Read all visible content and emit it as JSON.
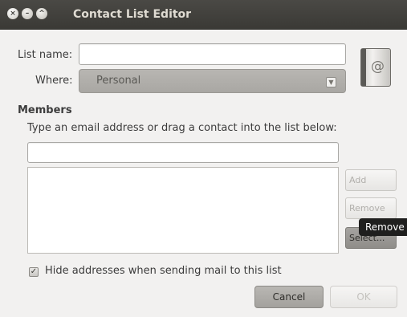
{
  "window": {
    "title": "Contact List Editor",
    "close_glyph": "×",
    "minimize_glyph": "–",
    "maximize_glyph": "^"
  },
  "form": {
    "list_name_label": "List name:",
    "list_name_value": "",
    "where_label": "Where:",
    "where_value": "Personal",
    "where_arrow": "▼",
    "icon_glyph": "@"
  },
  "members": {
    "title": "Members",
    "instruction": "Type an email address or drag a contact into the list below:",
    "email_value": "",
    "items": [],
    "add_label": "Add",
    "remove_label": "Remove",
    "select_label": "Select..."
  },
  "tooltip": {
    "text": "Remove"
  },
  "options": {
    "hide_addresses_label": "Hide addresses when sending mail to this list",
    "hide_addresses_checked": true,
    "check_glyph": "✓"
  },
  "actions": {
    "cancel_label": "Cancel",
    "ok_label": "OK"
  },
  "colors": {
    "titlebar": "#3c3b37",
    "window_bg": "#f2f1f0",
    "tooltip_bg": "#1f1f1e"
  }
}
